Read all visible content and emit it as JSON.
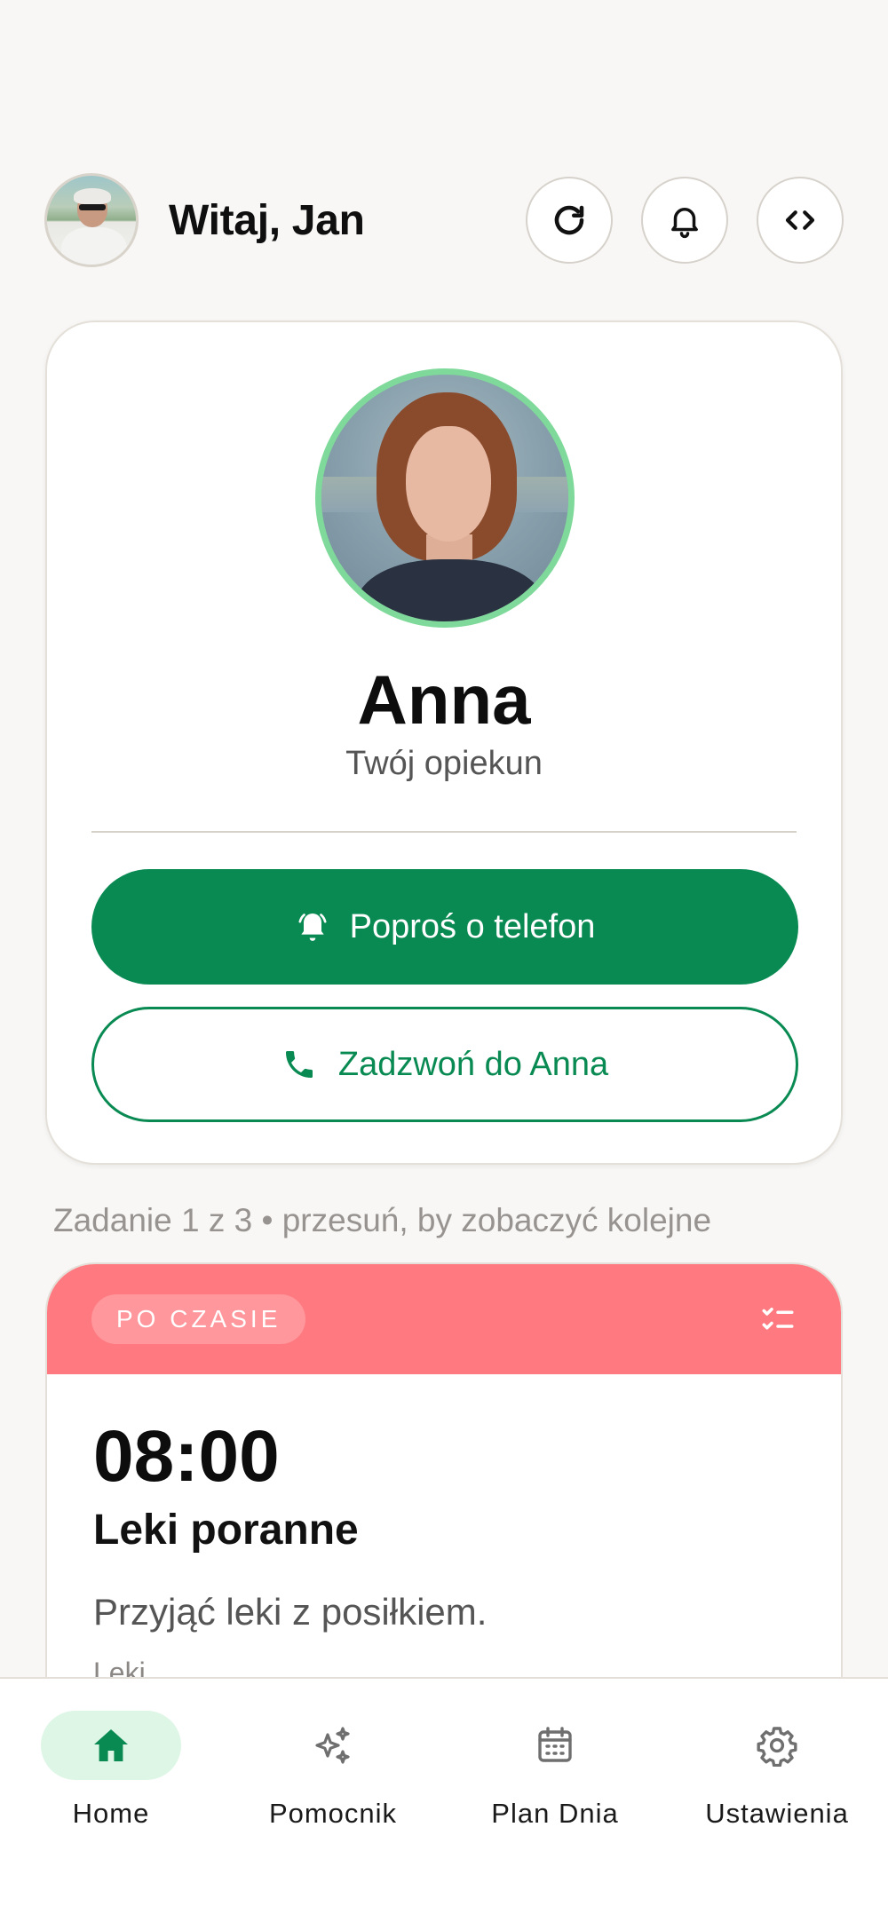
{
  "header": {
    "greeting": "Witaj, Jan",
    "avatar_icon": "user-avatar",
    "buttons": [
      {
        "name": "refresh-icon"
      },
      {
        "name": "bell-icon"
      },
      {
        "name": "code-icon"
      }
    ]
  },
  "caregiver": {
    "name": "Anna",
    "role": "Twój opiekun",
    "request_call_label": "Poproś o telefon",
    "call_label": "Zadzwoń do Anna",
    "accent_color": "#0a8a53",
    "avatar_ring_color": "#7fd99a"
  },
  "task_hint": "Zadanie 1 z 3 • przesuń, by zobaczyć kolejne",
  "task": {
    "status": "PO CZASIE",
    "status_color": "#ff7a80",
    "time": "08:00",
    "title": "Leki poranne",
    "description": "Przyjąć leki z posiłkiem.",
    "category": "Leki"
  },
  "nav": {
    "items": [
      {
        "label": "Home",
        "icon": "home-icon",
        "active": true
      },
      {
        "label": "Pomocnik",
        "icon": "sparkles-icon",
        "active": false
      },
      {
        "label": "Plan Dnia",
        "icon": "calendar-icon",
        "active": false
      },
      {
        "label": "Ustawienia",
        "icon": "gear-icon",
        "active": false
      }
    ]
  }
}
